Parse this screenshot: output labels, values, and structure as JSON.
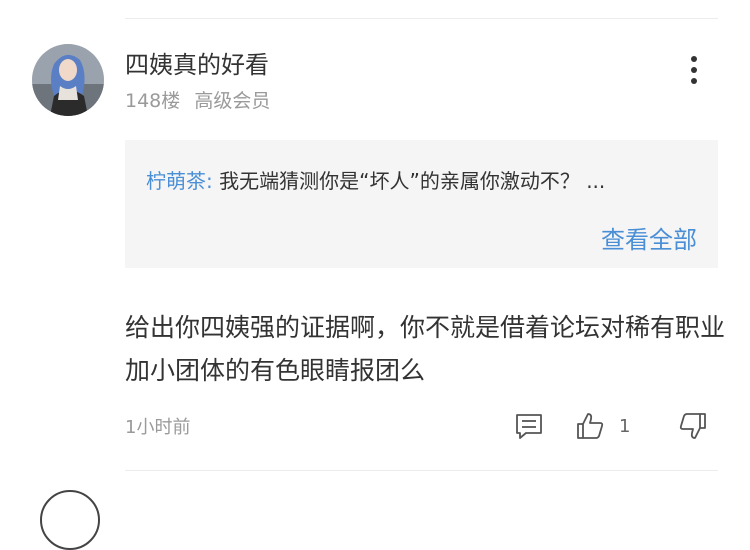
{
  "comment": {
    "username": "四姨真的好看",
    "floor": "148楼",
    "member_level": "高级会员",
    "reply_preview": {
      "author": "柠萌茶:",
      "text": "我无端猜测你是“坏人”的亲属你激动不？ ...",
      "view_all_label": "查看全部"
    },
    "body": "给出你四姨强的证据啊，你不就是借着论坛对稀有职业加小团体的有色眼睛报团么",
    "time": "1小时前",
    "like_count": "1"
  },
  "icons": {
    "more": "more-vertical-icon",
    "comment": "comment-icon",
    "like": "thumbs-up-icon",
    "dislike": "thumbs-down-icon"
  },
  "colors": {
    "accent": "#4a8fd6",
    "muted": "#9a9a9a",
    "reply_bg": "#f5f5f5"
  }
}
